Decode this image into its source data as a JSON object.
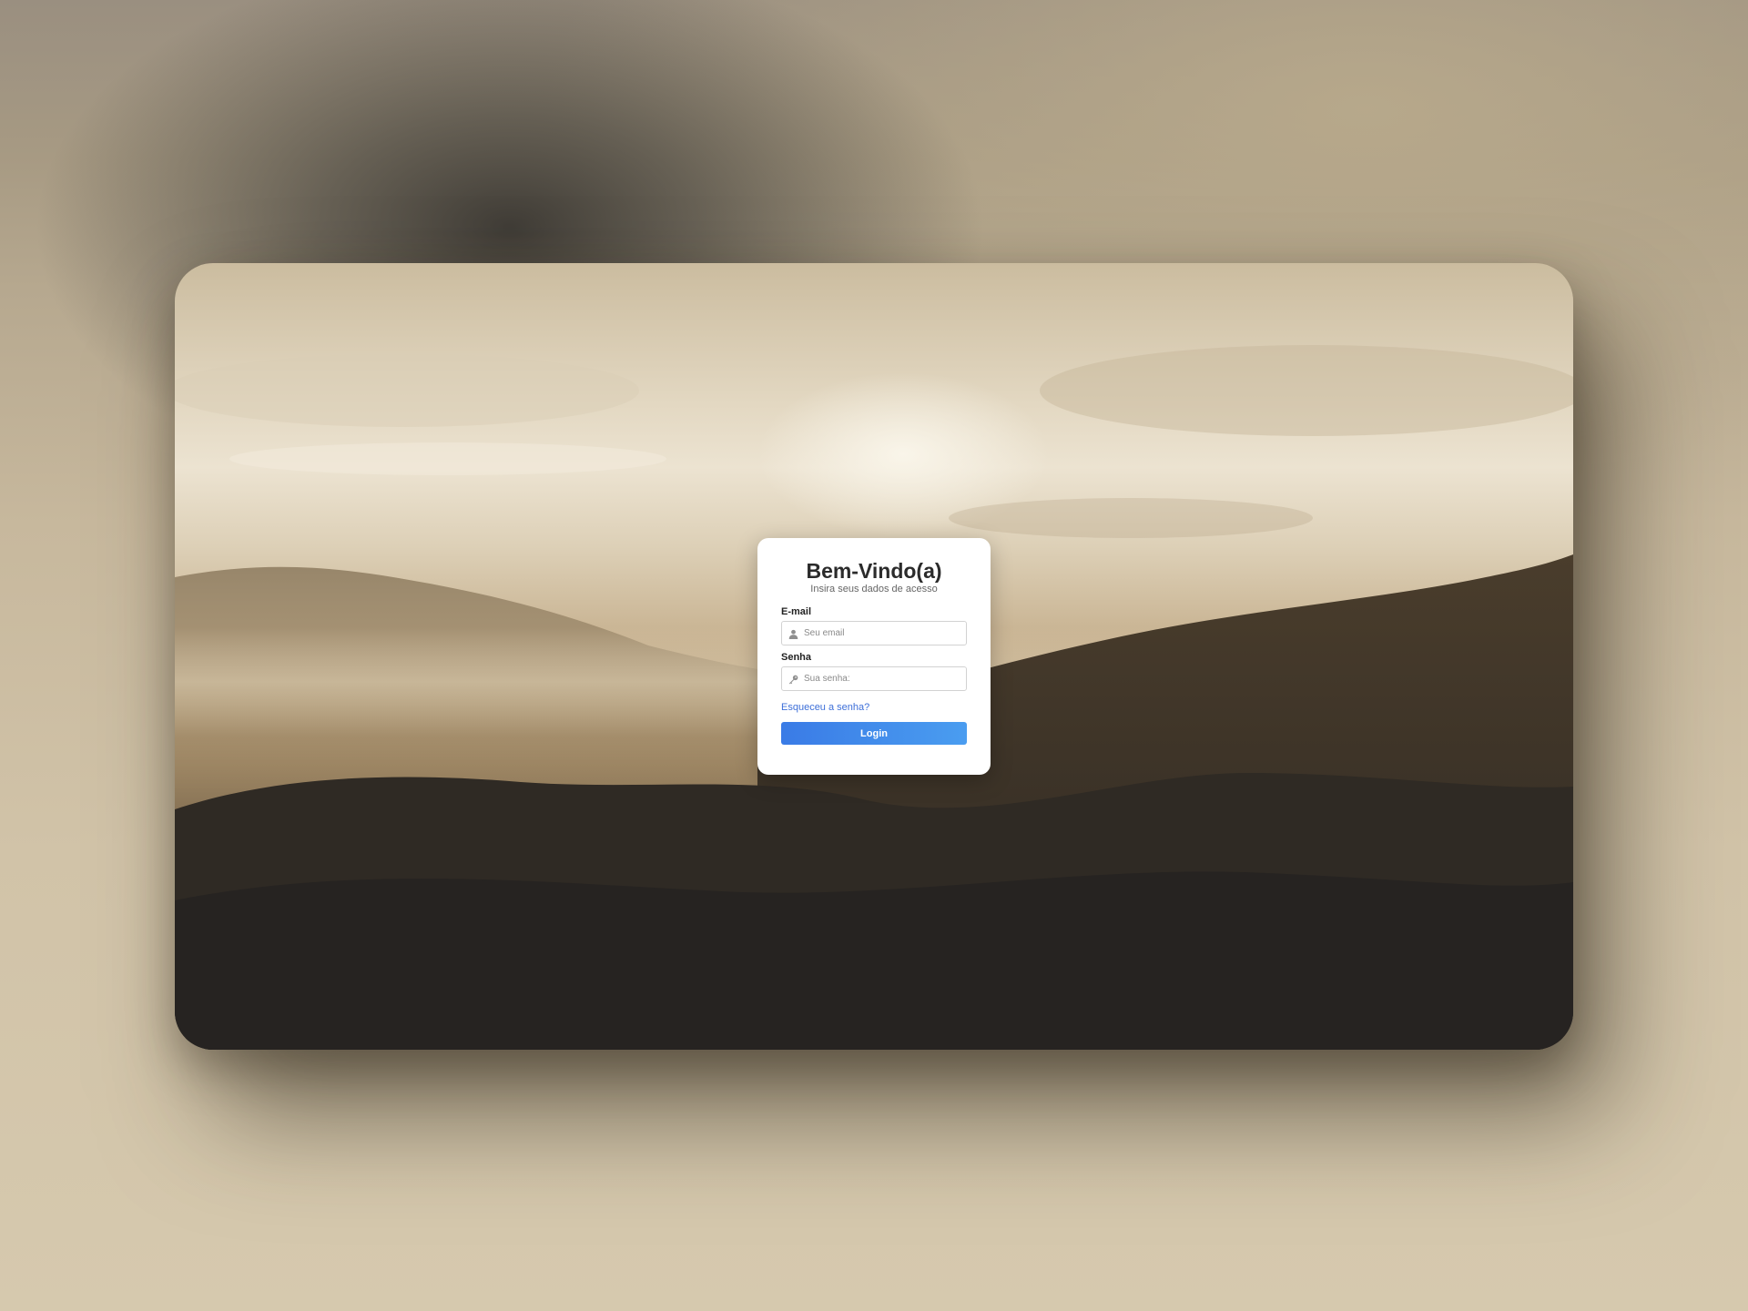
{
  "login": {
    "title": "Bem-Vindo(a)",
    "subtitle": "Insira seus dados de acesso",
    "email_label": "E-mail",
    "email_placeholder": "Seu email",
    "email_icon": "user-icon",
    "password_label": "Senha",
    "password_placeholder": "Sua senha:",
    "password_icon": "key-icon",
    "forgot_label": "Esqueceu a senha?",
    "login_button_label": "Login"
  },
  "colors": {
    "accent": "#3a7be6",
    "link": "#3d6fd9",
    "card_background": "#ffffff"
  }
}
